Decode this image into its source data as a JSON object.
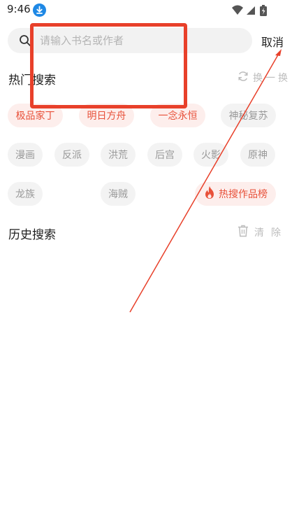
{
  "status_bar": {
    "time": "9:46",
    "icons": [
      "download-badge-icon",
      "wifi-icon",
      "signal-icon",
      "battery-icon"
    ]
  },
  "search": {
    "placeholder": "请输入书名或作者",
    "value": "",
    "cancel_label": "取消"
  },
  "hot_search": {
    "title": "热门搜索",
    "refresh_label": "换一换",
    "tags": [
      {
        "label": "极品家丁",
        "style": "hot"
      },
      {
        "label": "明日方舟",
        "style": "hot"
      },
      {
        "label": "一念永恒",
        "style": "hot"
      },
      {
        "label": "神秘复苏",
        "style": "normal"
      },
      {
        "label": "漫画",
        "style": "normal"
      },
      {
        "label": "反派",
        "style": "normal"
      },
      {
        "label": "洪荒",
        "style": "normal"
      },
      {
        "label": "后宫",
        "style": "normal"
      },
      {
        "label": "火影",
        "style": "normal"
      },
      {
        "label": "原神",
        "style": "normal"
      },
      {
        "label": "龙族",
        "style": "normal"
      },
      {
        "label": "海贼",
        "style": "normal"
      }
    ],
    "rank_label": "热搜作品榜"
  },
  "history": {
    "title": "历史搜索",
    "clear_label": "清除"
  },
  "colors": {
    "accent": "#e8513a",
    "hot_tag_bg": "#fdeeec",
    "normal_tag_bg": "#f3f3f3",
    "annotation": "#e8402a"
  }
}
